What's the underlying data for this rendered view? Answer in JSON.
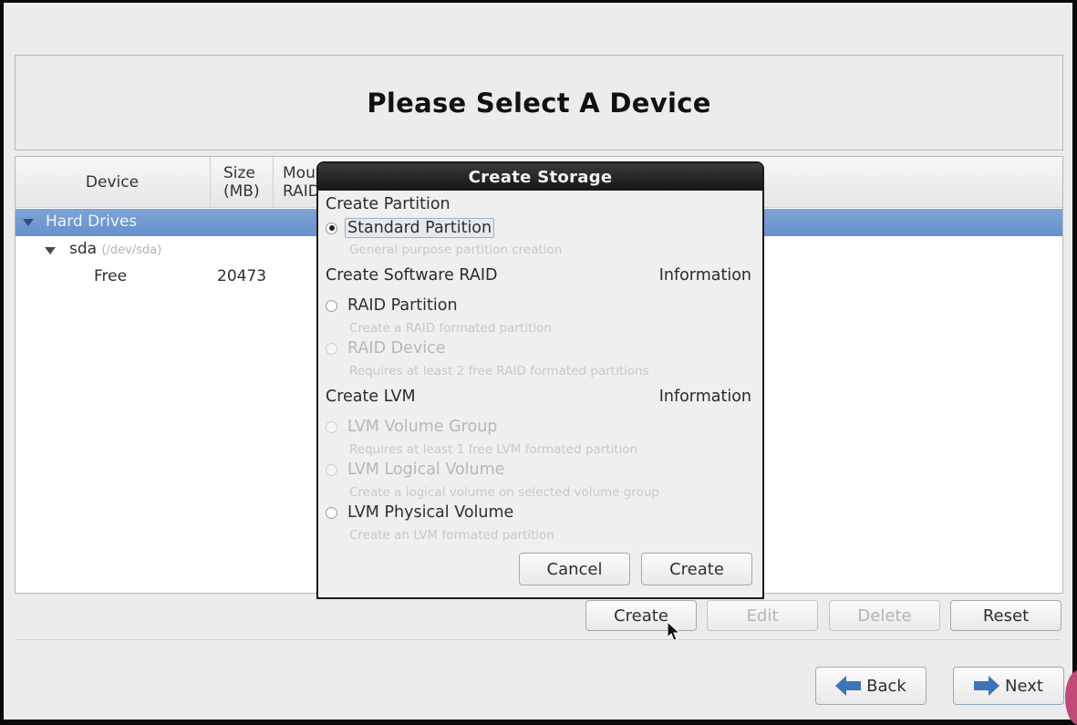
{
  "page": {
    "title": "Please Select A Device"
  },
  "device_tree": {
    "columns": {
      "device": "Device",
      "size_line1": "Size",
      "size_line2": "(MB)",
      "mount_line1": "Mou",
      "mount_line2": "RAID"
    },
    "rows": [
      {
        "label": "Hard Drives",
        "selected": true
      },
      {
        "label": "sda",
        "sublabel": "(/dev/sda)"
      },
      {
        "label": "Free",
        "size": "20473"
      }
    ]
  },
  "actions": {
    "create": "Create",
    "edit": "Edit",
    "delete": "Delete",
    "reset": "Reset"
  },
  "navigation": {
    "back": "Back",
    "next": "Next"
  },
  "dialog": {
    "title": "Create Storage",
    "sections": {
      "partition": "Create Partition",
      "raid": "Create Software RAID",
      "raid_info": "Information",
      "lvm": "Create LVM",
      "lvm_info": "Information"
    },
    "options": [
      {
        "label": "Standard Partition",
        "desc": "General purpose partition creation",
        "checked": true,
        "enabled": true
      },
      {
        "label": "RAID Partition",
        "desc": "Create a RAID formated partition",
        "checked": false,
        "enabled": true
      },
      {
        "label": "RAID Device",
        "desc": "Requires at least 2 free RAID formated partitions",
        "checked": false,
        "enabled": false
      },
      {
        "label": "LVM Volume Group",
        "desc": "Requires at least 1 free LVM formated partition",
        "checked": false,
        "enabled": false
      },
      {
        "label": "LVM Logical Volume",
        "desc": "Create a logical volume on selected volume group",
        "checked": false,
        "enabled": false
      },
      {
        "label": "LVM Physical Volume",
        "desc": "Create an LVM formated partition",
        "checked": false,
        "enabled": true
      }
    ],
    "buttons": {
      "cancel": "Cancel",
      "create": "Create"
    }
  },
  "colors": {
    "selection": "#6f98d1",
    "arrow": "#3d73b8"
  }
}
